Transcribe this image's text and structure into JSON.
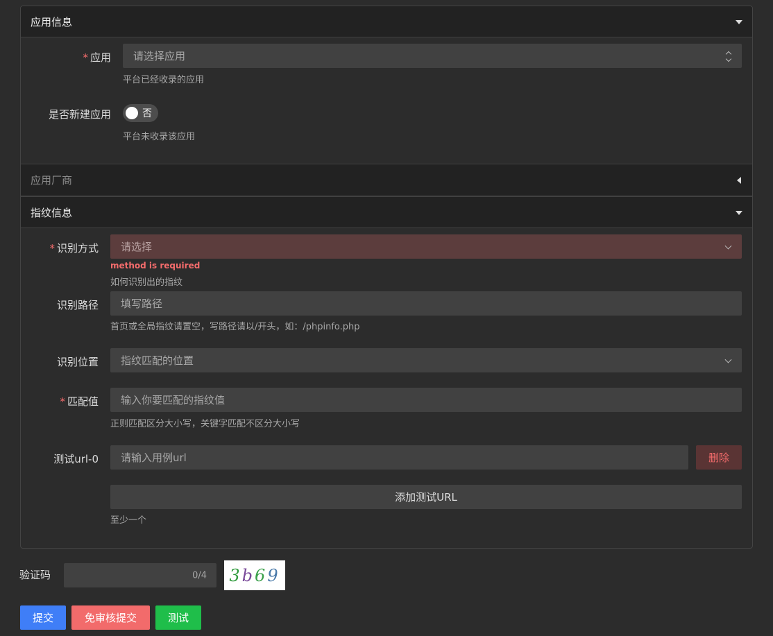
{
  "sections": {
    "app_info": "应用信息",
    "vendor": "应用厂商",
    "fingerprint": "指纹信息"
  },
  "app": {
    "required_mark": "*",
    "label": "应用",
    "placeholder": "请选择应用",
    "hint": "平台已经收录的应用"
  },
  "new_app": {
    "label": "是否新建应用",
    "switch_text": "否",
    "switch_on": false,
    "hint": "平台未收录该应用"
  },
  "method": {
    "required_mark": "*",
    "label": "识别方式",
    "placeholder": "请选择",
    "error": "method is required",
    "hint": "如何识别出的指纹"
  },
  "path": {
    "label": "识别路径",
    "placeholder": "填写路径",
    "hint": "首页或全局指纹请置空，写路径请以/开头，如：/phpinfo.php"
  },
  "position": {
    "label": "识别位置",
    "placeholder": "指纹匹配的位置"
  },
  "match": {
    "required_mark": "*",
    "label": "匹配值",
    "placeholder": "输入你要匹配的指纹值",
    "hint": "正则匹配区分大小写，关键字匹配不区分大小写"
  },
  "test_url": {
    "label": "测试url-0",
    "placeholder": "请输入用例url",
    "delete_label": "删除",
    "add_label": "添加测试URL",
    "hint": "至少一个"
  },
  "captcha": {
    "label": "验证码",
    "count": "0/4",
    "image_chars": [
      "3",
      "b",
      "6",
      "9"
    ],
    "image_colors": [
      "#2e9a3b",
      "#7a4a9a",
      "#3aa04a",
      "#4a7aaa"
    ]
  },
  "actions": {
    "submit": "提交",
    "submit_no_review": "免审核提交",
    "test": "测试"
  },
  "colors": {
    "submit": "#3f7ef7",
    "submit_no_review": "#f26b6b",
    "test": "#1fbe4a"
  }
}
